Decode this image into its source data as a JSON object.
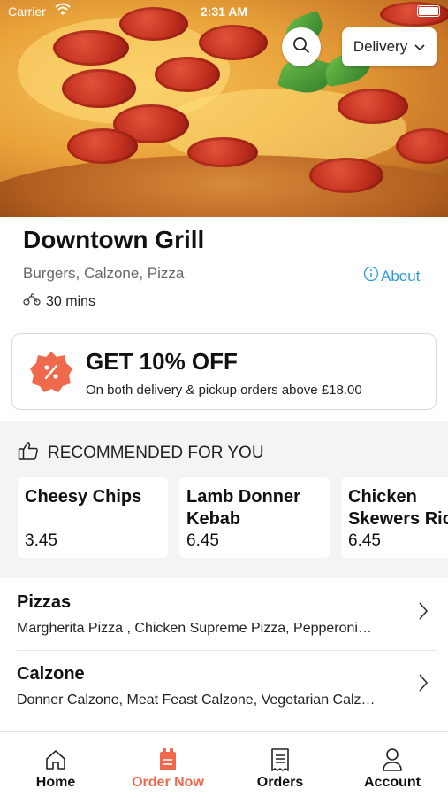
{
  "status_bar": {
    "carrier": "Carrier",
    "time": "2:31 AM"
  },
  "header": {
    "delivery_label": "Delivery"
  },
  "restaurant": {
    "name": "Downtown Grill",
    "cuisines": "Burgers, Calzone, Pizza",
    "about_label": "About",
    "delivery_time": "30 mins"
  },
  "offer": {
    "title": "GET 10% OFF",
    "subtitle": "On both delivery & pickup orders above £18.00"
  },
  "recommended": {
    "title": "RECOMMENDED FOR YOU",
    "items": [
      {
        "name": "Cheesy Chips",
        "price": "3.45"
      },
      {
        "name": "Lamb Donner Kebab",
        "name_line1": "Lamb Donner",
        "name_line2": "Kebab",
        "price": "6.45"
      },
      {
        "name": "Chicken Skewers Rice",
        "name_line1": "Chicken",
        "name_line2": "Skewers Rice",
        "price": "6.45"
      }
    ]
  },
  "categories": [
    {
      "title": "Pizzas",
      "items": "Margherita Pizza , Chicken Supreme Pizza, Pepperoni…"
    },
    {
      "title": "Calzone",
      "items": "Donner Calzone, Meat Feast Calzone, Vegetarian Calz…"
    }
  ],
  "tabbar": {
    "tabs": [
      {
        "label": "Home",
        "icon": "home-icon"
      },
      {
        "label": "Order Now",
        "icon": "order-bag-icon"
      },
      {
        "label": "Orders",
        "icon": "receipt-icon"
      },
      {
        "label": "Account",
        "icon": "person-icon"
      }
    ],
    "active": "Order Now"
  },
  "colors": {
    "accent": "#ef6a4c",
    "link": "#2b9ad6",
    "background": "#f4f4f4"
  }
}
